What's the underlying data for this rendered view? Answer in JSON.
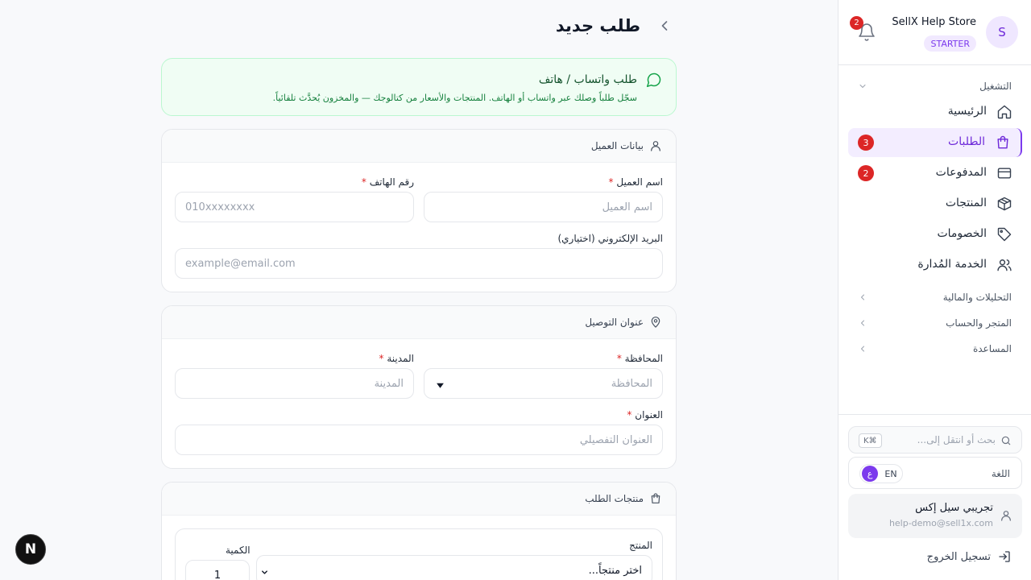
{
  "store": {
    "avatar_letter": "S",
    "name": "SellX Help Store",
    "plan": "STARTER",
    "notifications_count": "2"
  },
  "sidebar": {
    "section_operations": "التشغيل",
    "items": [
      {
        "label": "الرئيسية",
        "icon": "home-icon",
        "badge": null,
        "active": false
      },
      {
        "label": "الطلبات",
        "icon": "shopping-bag-icon",
        "badge": "3",
        "active": true
      },
      {
        "label": "المدفوعات",
        "icon": "credit-card-icon",
        "badge": "2",
        "active": false
      },
      {
        "label": "المنتجات",
        "icon": "box-icon",
        "badge": null,
        "active": false
      },
      {
        "label": "الخصومات",
        "icon": "tag-icon",
        "badge": null,
        "active": false
      },
      {
        "label": "الخدمة المُدارة",
        "icon": "users-icon",
        "badge": null,
        "active": false
      }
    ],
    "sections": [
      {
        "label": "التحليلات والمالية"
      },
      {
        "label": "المتجر والحساب"
      },
      {
        "label": "المساعدة"
      }
    ],
    "search_placeholder": "بحث أو انتقل إلى...",
    "search_shortcut": "K⌘",
    "language_label": "اللغة",
    "lang_en": "EN",
    "lang_ar": "ع",
    "user_name": "تجريبي سيل إكس",
    "user_email": "help-demo@sell1x.com",
    "logout_label": "تسجيل الخروج"
  },
  "page": {
    "title": "طلب جديد"
  },
  "whatsapp_card": {
    "title": "طلب واتساب / هاتف",
    "description": "سجّل طلباً وصلك عبر واتساب أو الهاتف. المنتجات والأسعار من كتالوجك — والمخزون يُحدَّث تلقائياً."
  },
  "customer": {
    "section_title": "بيانات العميل",
    "name_label": "اسم العميل",
    "name_placeholder": "اسم العميل",
    "phone_label": "رقم الهاتف",
    "phone_placeholder": "010xxxxxxxx",
    "email_label": "البريد الإلكتروني (اختياري)",
    "email_placeholder": "example@email.com"
  },
  "address": {
    "section_title": "عنوان التوصيل",
    "governorate_label": "المحافظة",
    "governorate_placeholder": "المحافظة",
    "city_label": "المدينة",
    "city_placeholder": "المدينة",
    "address_label": "العنوان",
    "address_placeholder": "العنوان التفصيلي"
  },
  "products": {
    "section_title": "منتجات الطلب",
    "product_label": "المنتج",
    "product_placeholder": "اختر منتجاً...",
    "quantity_label": "الكمية",
    "quantity_value": "1"
  },
  "required_mark": "*",
  "floating_button": "N"
}
